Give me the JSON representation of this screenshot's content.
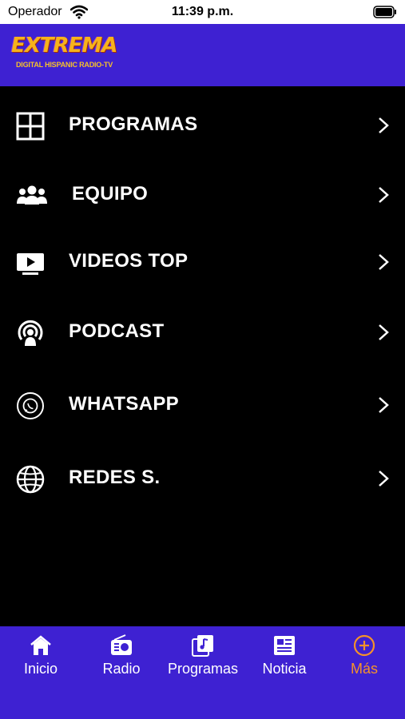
{
  "status_bar": {
    "carrier": "Operador",
    "time": "11:39 p.m."
  },
  "header": {
    "logo_text": "EXTREMA",
    "logo_tagline": "DIGITAL HISPANIC RADIO-TV"
  },
  "menu": {
    "items": [
      {
        "label": "PROGRAMAS",
        "icon": "grid-icon"
      },
      {
        "label": "EQUIPO",
        "icon": "people-group-icon"
      },
      {
        "label": "VIDEOS TOP",
        "icon": "tv-play-icon"
      },
      {
        "label": "PODCAST",
        "icon": "podcast-icon"
      },
      {
        "label": "WHATSAPP",
        "icon": "whatsapp-icon"
      },
      {
        "label": "REDES S.",
        "icon": "globe-icon"
      }
    ]
  },
  "tab_bar": {
    "tabs": [
      {
        "label": "Inicio",
        "icon": "home-icon"
      },
      {
        "label": "Radio",
        "icon": "radio-icon"
      },
      {
        "label": "Programas",
        "icon": "music-note-icon"
      },
      {
        "label": "Noticia",
        "icon": "newspaper-icon"
      },
      {
        "label": "Más",
        "icon": "plus-circle-icon"
      }
    ],
    "active_tab": "Más"
  },
  "colors": {
    "brand_blue": "#3e21d2",
    "background": "#000000",
    "active_tab": "#f5922a",
    "text": "#ffffff"
  }
}
